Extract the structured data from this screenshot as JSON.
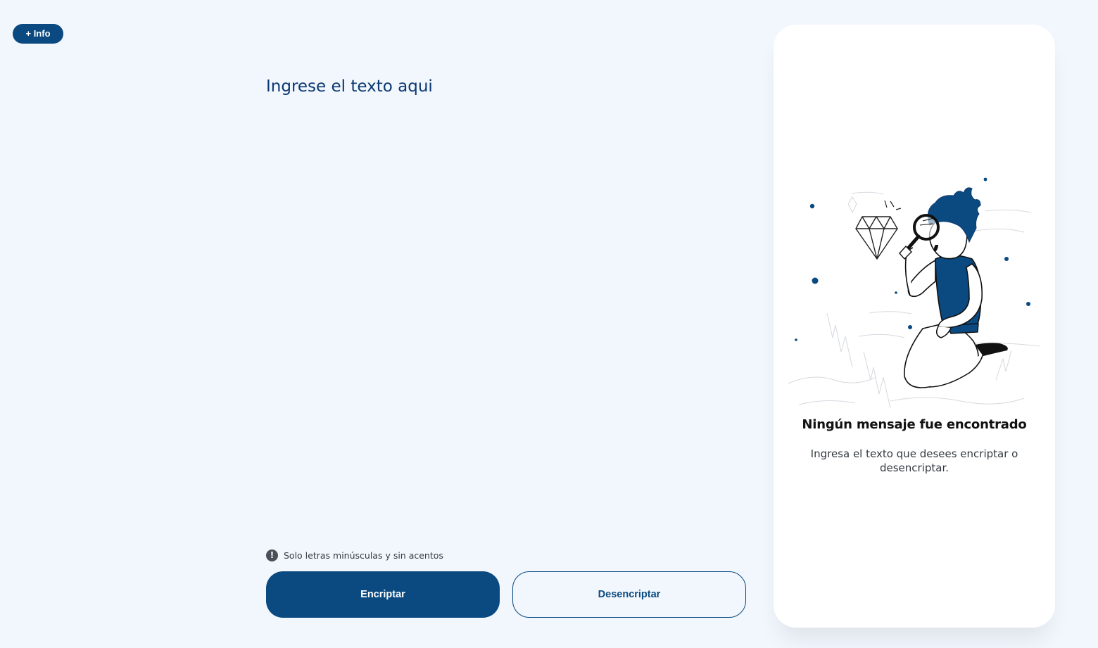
{
  "header": {
    "info_button_label": "+ Info"
  },
  "input": {
    "placeholder": "Ingrese el texto aqui",
    "value": ""
  },
  "hint": {
    "icon": "exclamation-circle-icon",
    "text": "Solo letras minúsculas y sin acentos"
  },
  "actions": {
    "encrypt_label": "Encriptar",
    "decrypt_label": "Desencriptar"
  },
  "result": {
    "illustration": "person-magnifying-glass-diamond-illustration",
    "title": "Ningún mensaje fue encontrado",
    "message": "Ingresa el texto que desees encriptar o desencriptar."
  },
  "colors": {
    "background": "#f2f6fd",
    "primary": "#0a4a80",
    "text_primary": "#0a3871",
    "panel": "#ffffff"
  }
}
